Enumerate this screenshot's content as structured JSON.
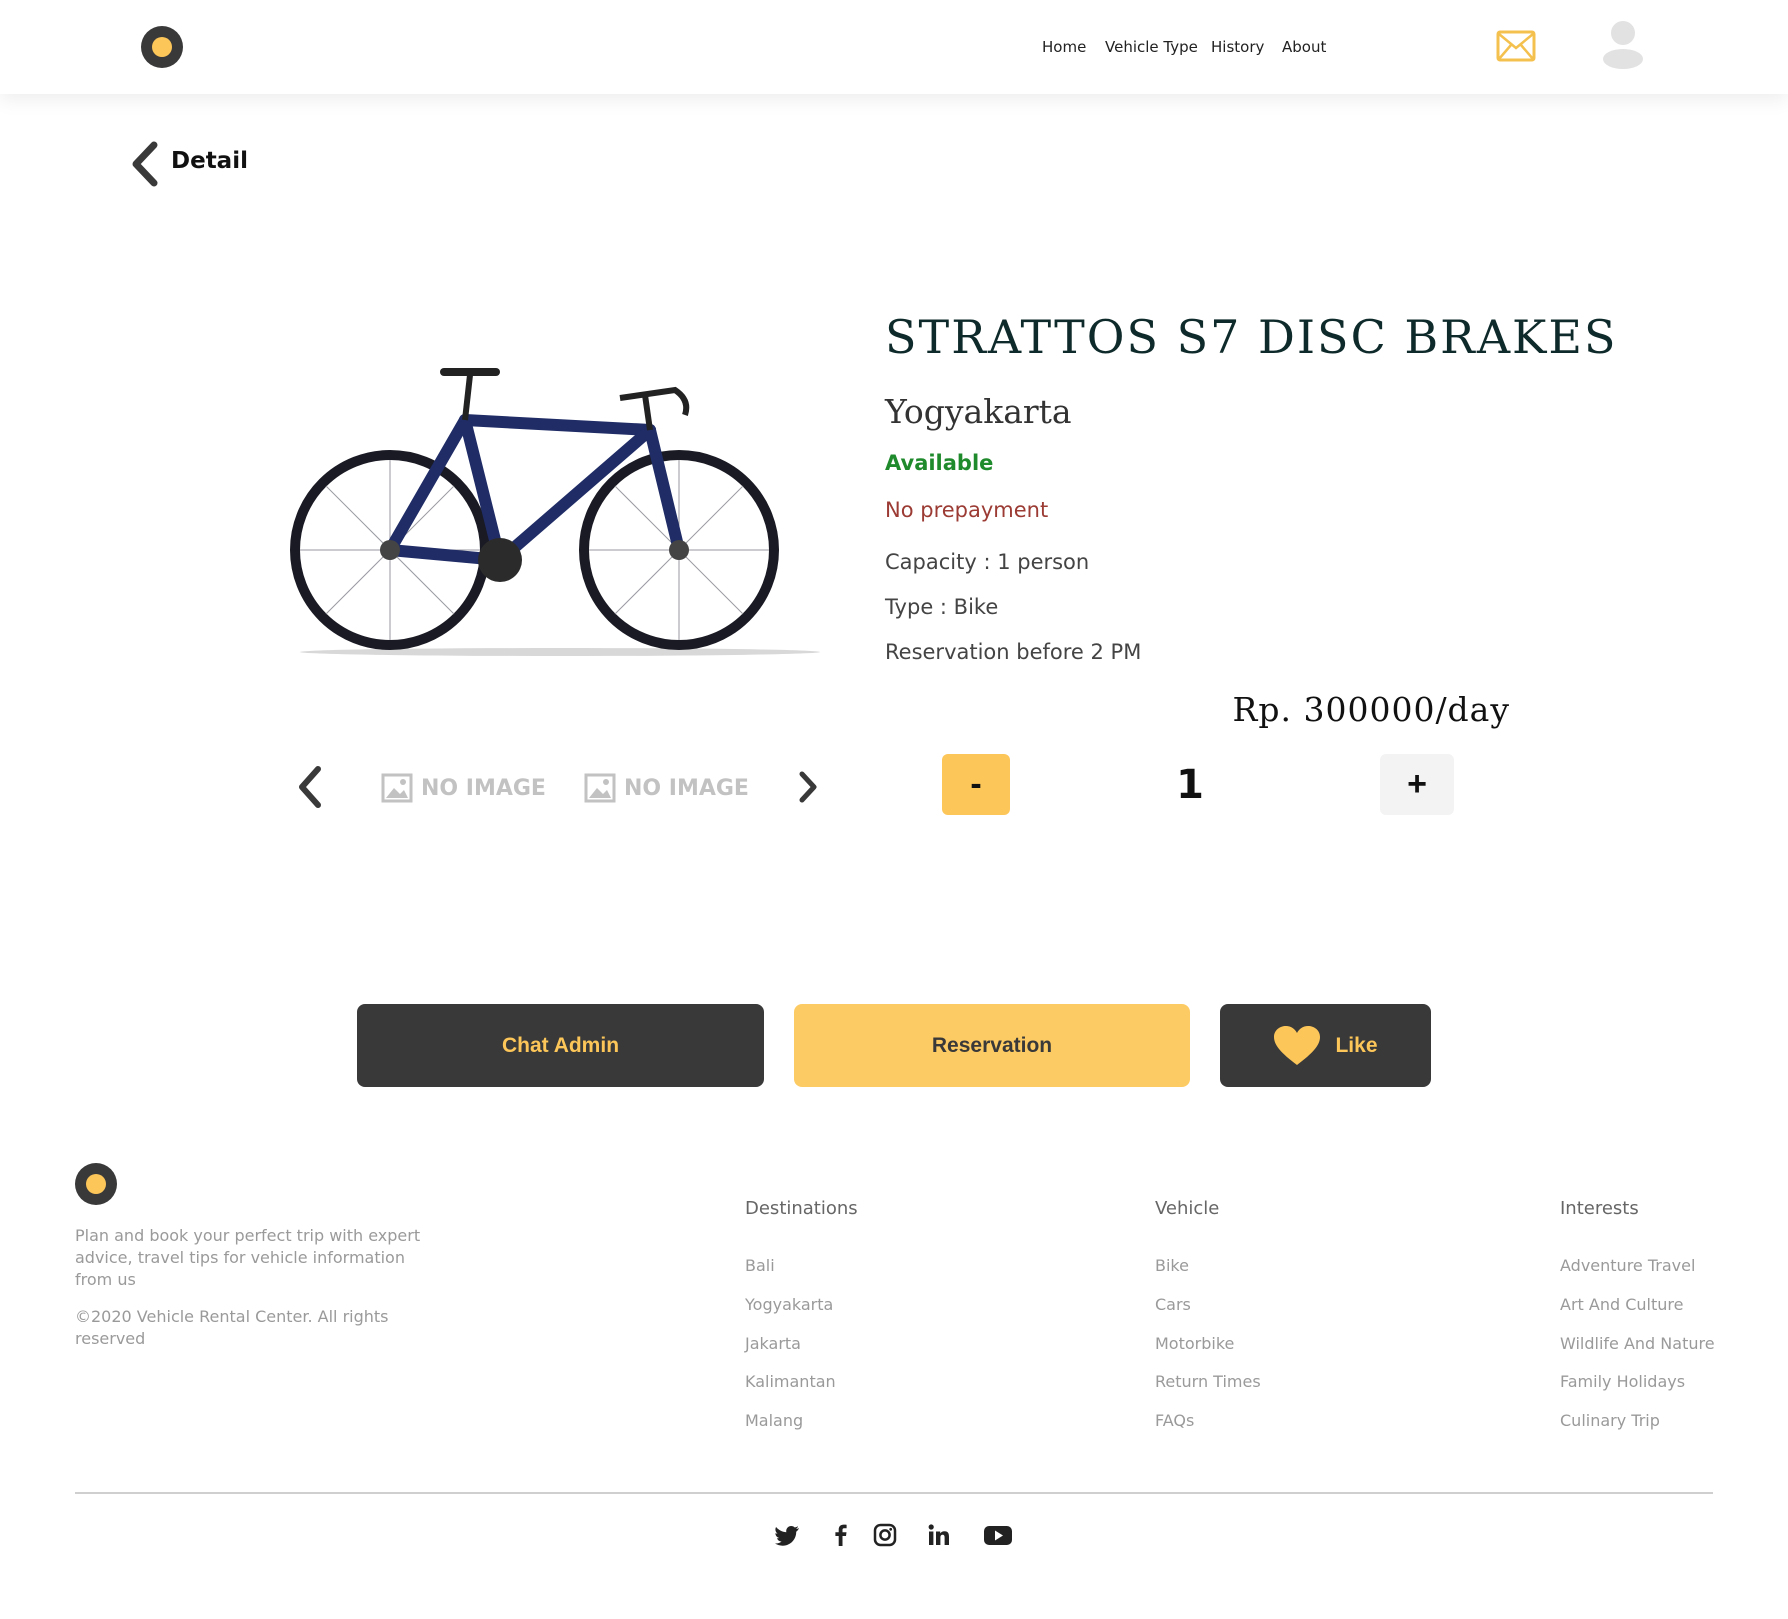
{
  "header": {
    "nav": [
      "Home",
      "Vehicle Type",
      "History",
      "About"
    ]
  },
  "page": {
    "title": "Detail"
  },
  "vehicle": {
    "name": "STRATTOS S7 DISC BRAKES",
    "city": "Yogyakarta",
    "status": "Available",
    "prepayment": "No prepayment",
    "capacity": "Capacity : 1 person",
    "type": "Type : Bike",
    "reservation_note": "Reservation before 2 PM",
    "price": "Rp. 300000/day"
  },
  "gallery": {
    "placeholder": "NO IMAGE"
  },
  "stepper": {
    "minus": "-",
    "quantity": "1",
    "plus": "+"
  },
  "actions": {
    "chat": "Chat Admin",
    "reservation": "Reservation",
    "like": "Like"
  },
  "footer": {
    "description": "Plan and book your perfect trip with expert advice, travel tips for vehicle information from us",
    "copyright": "©2020 Vehicle Rental Center. All rights reserved",
    "columns": [
      {
        "title": "Destinations",
        "items": [
          "Bali",
          "Yogyakarta",
          "Jakarta",
          "Kalimantan",
          "Malang"
        ]
      },
      {
        "title": "Vehicle",
        "items": [
          "Bike",
          "Cars",
          "Motorbike",
          "Return Times",
          "FAQs"
        ]
      },
      {
        "title": "Interests",
        "items": [
          "Adventure Travel",
          "Art And Culture",
          "Wildlife And Nature",
          "Family Holidays",
          "Culinary Trip"
        ]
      }
    ],
    "social": [
      "twitter-icon",
      "facebook-icon",
      "instagram-icon",
      "linkedin-icon",
      "youtube-icon"
    ]
  },
  "colors": {
    "accent": "#fdc659",
    "dark": "#393939",
    "available": "#1f8a2c",
    "prepayment": "#9b3b34"
  }
}
